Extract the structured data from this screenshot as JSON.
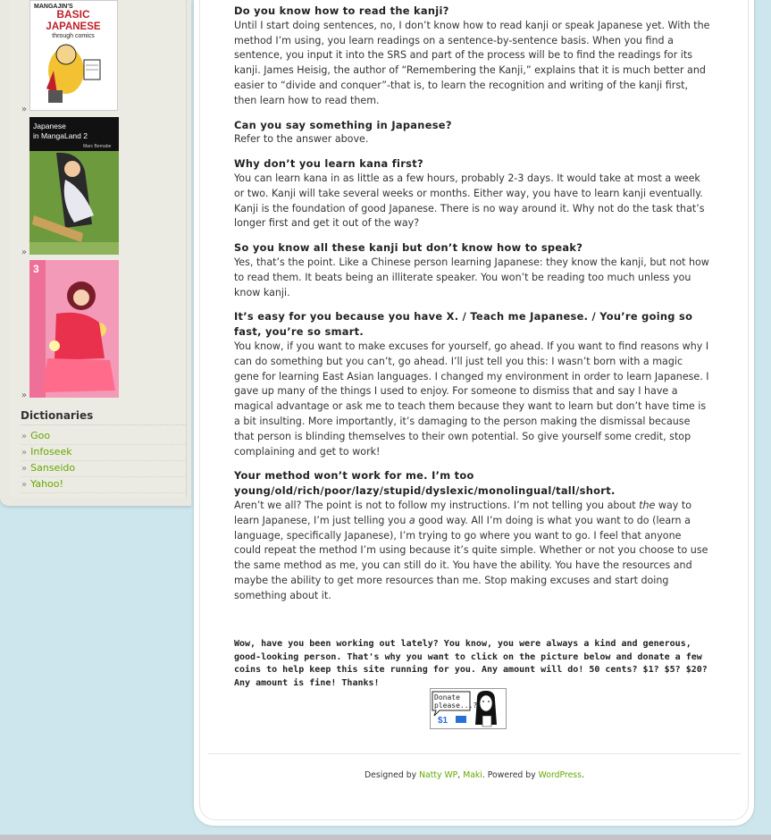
{
  "sidebar": {
    "books": [
      {
        "name": "book-basic-japanese",
        "title": "BASIC JAPANESE",
        "subtitle": "through comics",
        "brand": "MANGAJIN'S"
      },
      {
        "name": "book-japanese-in-mangaland-2",
        "title": "Japanese in MangaLand 2",
        "author": "Marc Bernabe"
      },
      {
        "name": "book-sailor-moon-3",
        "title": "3"
      }
    ],
    "bullet": "»",
    "dictionaries_heading": "Dictionaries",
    "dictionaries": [
      {
        "label": "Goo"
      },
      {
        "label": "Infoseek"
      },
      {
        "label": "Sanseido"
      },
      {
        "label": "Yahoo!"
      }
    ]
  },
  "main": {
    "faq": [
      {
        "q": "Do you know how to read the kanji?",
        "a": "Until I start doing sentences, no, I don’t know how to read kanji or speak Japanese yet. With the method I’m using, you learn readings on a sentence-by-sentence basis. When you find a sentence, you input it into the SRS and part of the process will be to find the readings for its kanji. James Heisig, the author of “Remembering the Kanji,” explains that it is much better and easier to “divide and conquer”-that is, to learn the recognition and writing of the kanji first, then learn how to read them."
      },
      {
        "q": "Can you say something in Japanese?",
        "a": "Refer to the answer above."
      },
      {
        "q": "Why don’t you learn kana first?",
        "a": "You can learn kana in as little as a few hours, probably 2-3 days. It would take at most a week or two. Kanji will take several weeks or months. Either way, you have to learn kanji eventually. Kanji is the foundation of good Japanese. There is no way around it. Why not do the task that’s longer first and get it out of the way?"
      },
      {
        "q": "So you know all these kanji but don’t know how to speak?",
        "a": "Yes, that’s the point. Like a Chinese person learning Japanese: they know the kanji, but not how to read them. It beats being an illiterate speaker. You won’t be reading too much unless you know kanji."
      },
      {
        "q": "It’s easy for you because you have X. / Teach me Japanese. / You’re going so fast, you’re so smart.",
        "a": "You know, if you want to make excuses for yourself, go ahead. If you want to find reasons why I can do something but you can’t, go ahead. I’ll just tell you this: I wasn’t born with a magic gene for learning East Asian languages. I changed my environment in order to learn Japanese. I gave up many of the things I used to enjoy. For someone to dismiss that and say I have a magical advantage or ask me to teach them because they want to learn but don’t have time is a bit insulting. More importantly, it’s damaging to the person making the dismissal because that person is blinding themselves to their own potential. So give yourself some credit, stop complaining and get to work!"
      },
      {
        "q": "Your method won’t work for me. I’m too young/old/rich/poor/lazy/stupid/dyslexic/monolingual/tall/short.",
        "a_before": "Aren’t we all? The point is not to follow my instructions. I’m not telling you about ",
        "a_em1": "the",
        "a_mid": " way to learn Japanese, I’m just telling you ",
        "a_em2": "a",
        "a_after": " good way. All I’m doing is what you want to do (learn a language, specifically Japanese), I’m trying to go where you want to go. I feel that anyone could repeat the method I’m using because it’s quite simple. Whether or not you choose to use the same method as me, you can still do it. You have the ability. You have the resources and maybe the ability to get more resources than me. Stop making excuses and start doing something about it."
      }
    ],
    "donate_message": "Wow, have you been working out lately? You know, you were always a kind and generous, good-looking person. That's why you want to click on the picture below and donate a few coins to help keep this site running for you. Any amount will do! 50 cents? $1? $5? $20? Any amount is fine! Thanks!",
    "donate_button": {
      "line1": "Donate",
      "line2": "please...?",
      "amount": "$1"
    }
  },
  "footer": {
    "prefix": "Designed by ",
    "link1": "Natty WP",
    "sep": ", ",
    "link2": "Maki",
    "mid": ". Powered by ",
    "link3": "WordPress",
    "suffix": "."
  },
  "colors": {
    "background": "#cde5ec",
    "sidebar": "#ecebe3",
    "link": "#66a800",
    "text": "#333333"
  }
}
